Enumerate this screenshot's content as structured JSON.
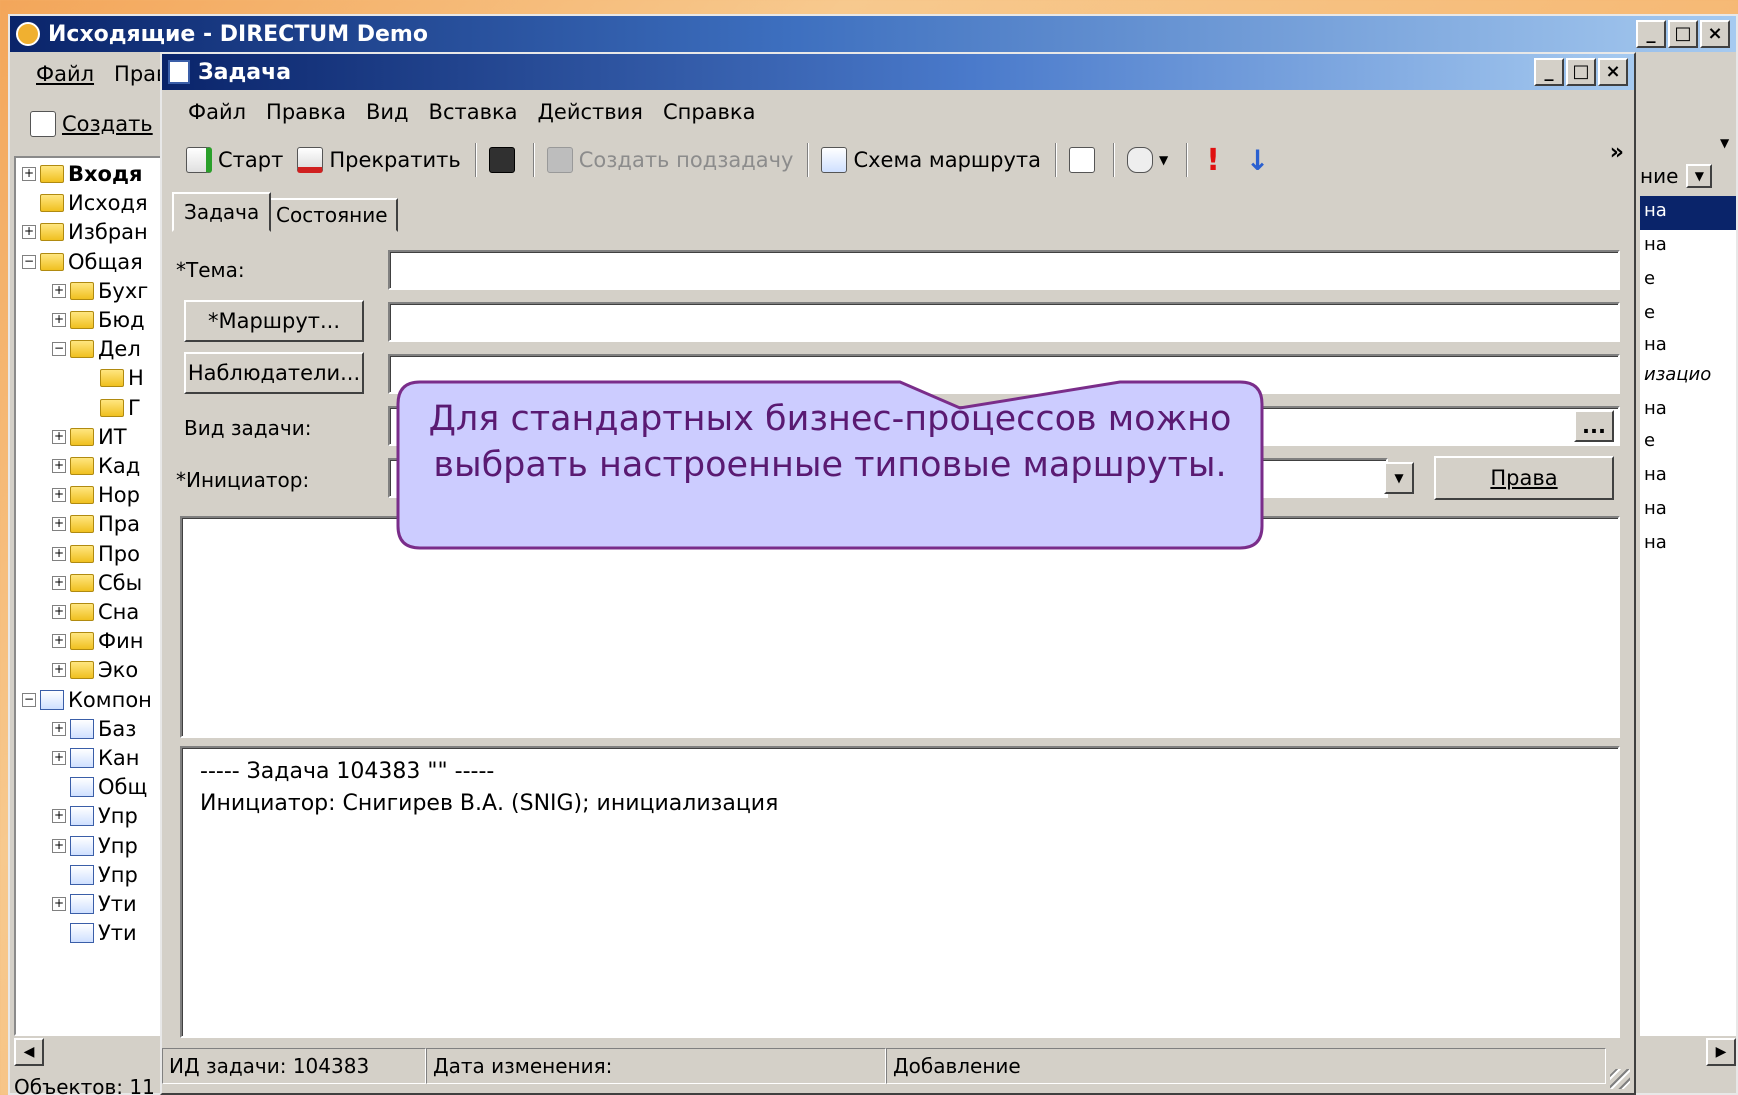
{
  "main_window": {
    "title": "Исходящие - DIRECTUM Demo",
    "menu": [
      "Файл",
      "Прав"
    ],
    "create_label": "Создать",
    "column_header": "ние",
    "status": "Объектов: 11"
  },
  "tree": [
    {
      "label": "Входя",
      "bold": true
    },
    {
      "label": "Исходя"
    },
    {
      "label": "Избран"
    },
    {
      "label": "Общая"
    },
    {
      "label": "Бухг"
    },
    {
      "label": "Бюд"
    },
    {
      "label": "Дел"
    },
    {
      "label": "Н"
    },
    {
      "label": "Г"
    },
    {
      "label": "ИТ"
    },
    {
      "label": "Кад"
    },
    {
      "label": "Нор"
    },
    {
      "label": "Пра"
    },
    {
      "label": "Про"
    },
    {
      "label": "Сбы"
    },
    {
      "label": "Сна"
    },
    {
      "label": "Фин"
    },
    {
      "label": "Эко"
    },
    {
      "label": "Компон"
    },
    {
      "label": "Баз"
    },
    {
      "label": "Кан"
    },
    {
      "label": "Общ"
    },
    {
      "label": "Упр"
    },
    {
      "label": "Упр"
    },
    {
      "label": "Упр"
    },
    {
      "label": "Ути"
    },
    {
      "label": "Ути"
    }
  ],
  "right_list": [
    "на",
    "на",
    "е",
    "е",
    "на",
    "изацио",
    "на",
    "е",
    "на",
    "на",
    "на"
  ],
  "task_window": {
    "title": "Задача",
    "menu": [
      "Файл",
      "Правка",
      "Вид",
      "Вставка",
      "Действия",
      "Справка"
    ],
    "toolbar": {
      "start": "Старт",
      "stop": "Прекратить",
      "subtask": "Создать подзадачу",
      "route_scheme": "Схема маршрута",
      "more": "»"
    },
    "tabs": [
      "Задача",
      "Состояние"
    ],
    "labels": {
      "topic": "*Тема:",
      "task_type": "Вид задачи:",
      "initiator": "*Инициатор:"
    },
    "buttons": {
      "route": "*Маршрут...",
      "observers": "Наблюдатели...",
      "rights": "Права",
      "ellipsis": "..."
    },
    "log": {
      "line1": "----- Задача 104383 \"\" -----",
      "line2": "Инициатор: Снигирев В.А. (SNIG); инициализация"
    },
    "status": {
      "id": "ИД задачи: 104383",
      "changed": "Дата изменения:",
      "mode": "Добавление"
    }
  },
  "callout": {
    "text": "Для стандартных бизнес-процессов можно выбрать настроенные типовые маршруты."
  },
  "colors": {
    "callout_bg": "#ccccff",
    "callout_border": "#7a2d8a",
    "callout_text": "#5a1a72"
  }
}
